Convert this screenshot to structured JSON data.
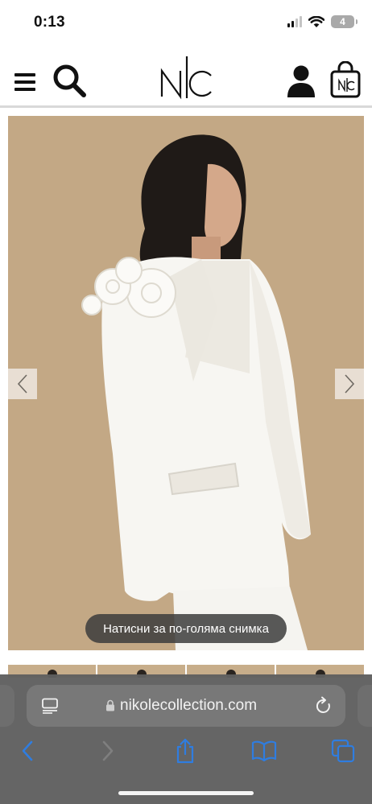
{
  "status_bar": {
    "time": "0:13",
    "battery": "4"
  },
  "header": {
    "logo_text": "NC",
    "bag_logo_text": "NC"
  },
  "product": {
    "zoom_hint": "Натисни за по-голяма снимка"
  },
  "safari": {
    "url": "nikolecollection.com"
  },
  "colors": {
    "image_background": "#c7ad8a",
    "safari_bar": "#5f5f5f",
    "address_field": "#787878",
    "toolbar_accent": "#2f7de0"
  }
}
